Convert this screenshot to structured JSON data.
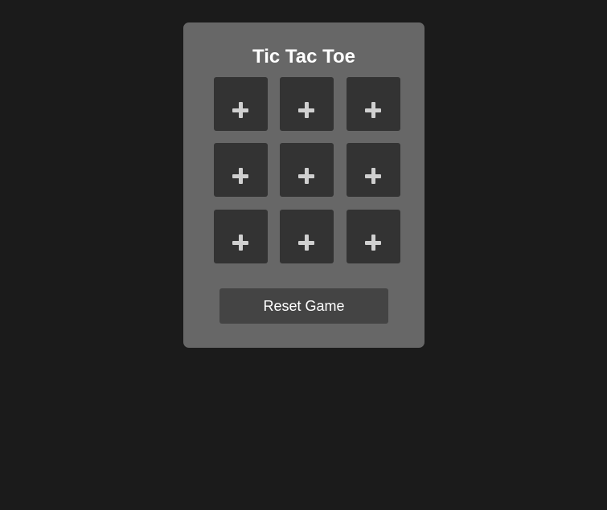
{
  "game": {
    "title": "Tic Tac Toe",
    "reset_label": "Reset Game",
    "cells": [
      {
        "row": 1,
        "col": 1,
        "value": "",
        "icon": "plus-icon"
      },
      {
        "row": 1,
        "col": 2,
        "value": "",
        "icon": "plus-icon"
      },
      {
        "row": 1,
        "col": 3,
        "value": "",
        "icon": "plus-icon"
      },
      {
        "row": 2,
        "col": 1,
        "value": "",
        "icon": "plus-icon"
      },
      {
        "row": 2,
        "col": 2,
        "value": "",
        "icon": "plus-icon"
      },
      {
        "row": 2,
        "col": 3,
        "value": "",
        "icon": "plus-icon"
      },
      {
        "row": 3,
        "col": 1,
        "value": "",
        "icon": "plus-icon"
      },
      {
        "row": 3,
        "col": 2,
        "value": "",
        "icon": "plus-icon"
      },
      {
        "row": 3,
        "col": 3,
        "value": "",
        "icon": "plus-icon"
      }
    ]
  },
  "colors": {
    "page_background": "#1b1b1b",
    "panel_background": "#676767",
    "cell_background": "#333333",
    "button_background": "#444444",
    "icon_color": "#d0d0d0",
    "text_color": "#ffffff"
  }
}
